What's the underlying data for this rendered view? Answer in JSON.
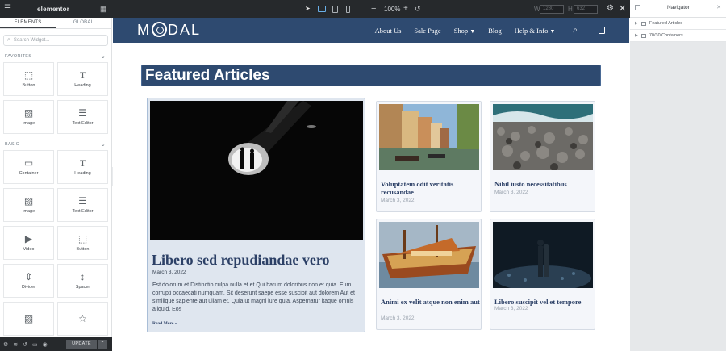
{
  "topbar": {
    "brand": "elementor",
    "zoom": "100%",
    "width_value": "1280",
    "height_value": "632",
    "width_label": "W",
    "height_label": "H"
  },
  "panel": {
    "tabs": [
      "ELEMENTS",
      "GLOBAL"
    ],
    "search_placeholder": "Search Widget...",
    "favorites_label": "FAVORITES",
    "basic_label": "BASIC",
    "favorites": [
      {
        "label": "Button",
        "icon": "button-icon"
      },
      {
        "label": "Heading",
        "icon": "heading-icon"
      },
      {
        "label": "Image",
        "icon": "image-icon"
      },
      {
        "label": "Text Editor",
        "icon": "text-editor-icon"
      }
    ],
    "basic": [
      {
        "label": "Container",
        "icon": "container-icon"
      },
      {
        "label": "Heading",
        "icon": "heading-icon"
      },
      {
        "label": "Image",
        "icon": "image-icon"
      },
      {
        "label": "Text Editor",
        "icon": "text-editor-icon"
      },
      {
        "label": "Video",
        "icon": "video-icon"
      },
      {
        "label": "Button",
        "icon": "button-icon"
      },
      {
        "label": "Divider",
        "icon": "divider-icon"
      },
      {
        "label": "Spacer",
        "icon": "spacer-icon"
      }
    ],
    "update_label": "UPDATE"
  },
  "site": {
    "logo": {
      "pre": "M",
      "post": "DAL"
    },
    "menu": [
      "About Us",
      "Sale Page",
      "Shop",
      "Blog",
      "Help & Info"
    ],
    "section_title": "Featured Articles",
    "featured": {
      "title": "Libero sed repudiandae vero",
      "date": "March 3, 2022",
      "excerpt": "Est dolorum et Distinctio culpa nulla et et Qui harum doloribus non et quia. Eum corrupti occaecati numquam. Sit deserunt saepe esse suscipit aut dolorem Aut et similique sapiente aut ullam et. Quia ut magni iure quia. Aspernatur itaque omnis aliquid. Eos",
      "read_more": "Read More »"
    },
    "cards": [
      {
        "title": "Voluptatem odit veritatis recusandae",
        "date": "March 3, 2022"
      },
      {
        "title": "Nihil iusto necessitatibus",
        "date": "March 3, 2022"
      },
      {
        "title": "Animi ex velit atque non enim aut",
        "date": "March 3, 2022"
      },
      {
        "title": "Libero suscipit vel et tempore",
        "date": "March 3, 2022"
      }
    ]
  },
  "navigator": {
    "title": "Navigator",
    "items": [
      "Featured Articles",
      "70/30 Containers"
    ]
  },
  "colors": {
    "brand_blue": "#2e4a70",
    "toolbar_dark": "#26292c"
  }
}
